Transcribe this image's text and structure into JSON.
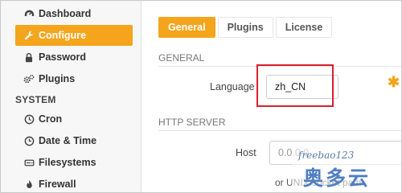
{
  "sidebar": {
    "items": [
      {
        "label": "Dashboard",
        "icon": "dashboard-icon",
        "active": false
      },
      {
        "label": "Configure",
        "icon": "wrench-icon",
        "active": true
      },
      {
        "label": "Password",
        "icon": "lock-icon",
        "active": false
      },
      {
        "label": "Plugins",
        "icon": "cogs-icon",
        "active": false
      }
    ],
    "system_section": "SYSTEM",
    "system_items": [
      {
        "label": "Cron",
        "icon": "clock-icon"
      },
      {
        "label": "Date & Time",
        "icon": "calendar-clock-icon"
      },
      {
        "label": "Filesystems",
        "icon": "hard-drive-icon"
      },
      {
        "label": "Firewall",
        "icon": "fire-icon"
      }
    ]
  },
  "tabs": [
    {
      "label": "General",
      "active": true
    },
    {
      "label": "Plugins",
      "active": false
    },
    {
      "label": "License",
      "active": false
    }
  ],
  "general": {
    "heading": "GENERAL",
    "language_label": "Language",
    "language_value": "zh_CN"
  },
  "http_server": {
    "heading": "HTTP SERVER",
    "host_label": "Host",
    "host_placeholder": "0.0.0.0",
    "host_help": "or UNIX socket path"
  },
  "watermark": {
    "handle": "freebao123",
    "text": "奥多云"
  },
  "colors": {
    "accent": "#f4a51c",
    "highlight": "#d9202b",
    "watermark": "#4f7fc1"
  }
}
